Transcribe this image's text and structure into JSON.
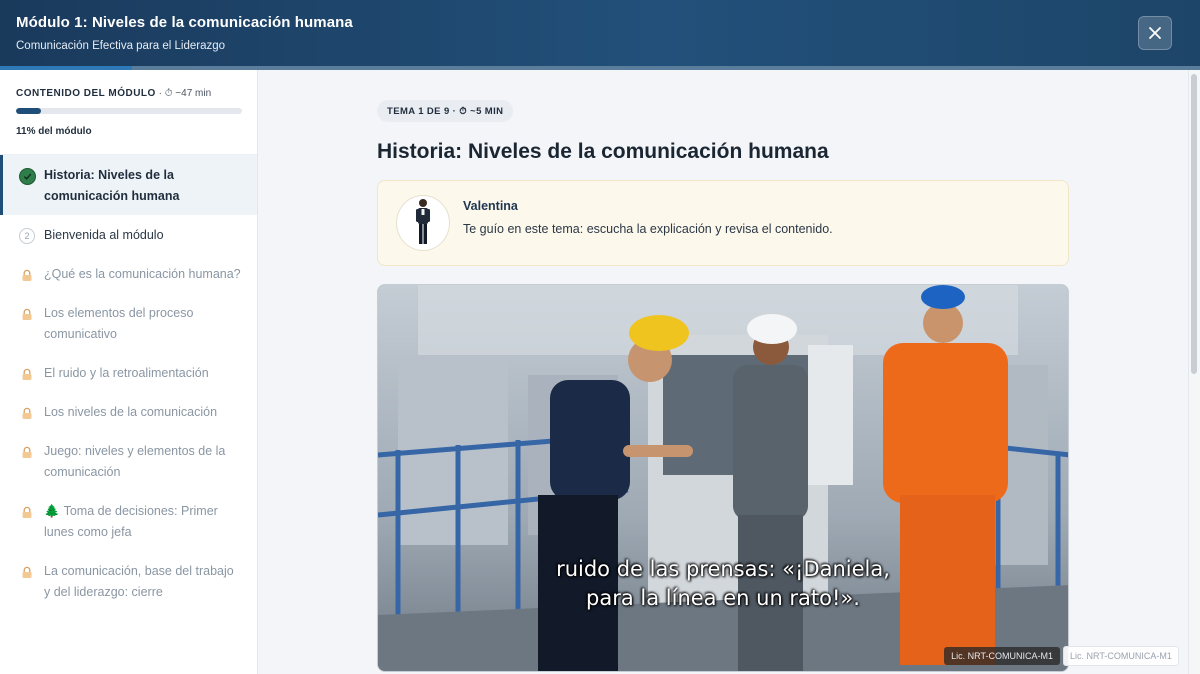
{
  "header": {
    "title": "Módulo 1: Niveles de la comunicación humana",
    "subtitle": "Comunicación Efectiva para el Liderazgo",
    "close_icon": "close-icon",
    "progress": 0.11
  },
  "sidebar": {
    "heading": "CONTENIDO DEL MÓDULO",
    "duration": " · ⏱ ~47 min",
    "progress": 0.11,
    "progress_label": "11% del módulo",
    "items": [
      {
        "label": "Historia: Niveles de la comunicación humana",
        "state": "done",
        "icon": "check-circle-icon"
      },
      {
        "label": "Bienvenida al módulo",
        "state": "next",
        "number": "2",
        "icon": "number-circle-icon"
      },
      {
        "label": "¿Qué es la comunicación humana?",
        "state": "locked",
        "icon": "lock-icon"
      },
      {
        "label": "Los elementos del proceso comunicativo",
        "state": "locked",
        "icon": "lock-icon"
      },
      {
        "label": "El ruido y la retroalimentación",
        "state": "locked",
        "icon": "lock-icon"
      },
      {
        "label": "Los niveles de la comunicación",
        "state": "locked",
        "icon": "lock-icon"
      },
      {
        "label": "Juego: niveles y elementos de la comunicación",
        "state": "locked",
        "icon": "lock-icon"
      },
      {
        "label": "Toma de decisiones: Primer lunes como jefa",
        "state": "locked",
        "icon": "lock-icon",
        "prefix_icon": "tree-icon"
      },
      {
        "label": "La comunicación, base del trabajo y del liderazgo: cierre",
        "state": "locked",
        "icon": "lock-icon"
      }
    ]
  },
  "main": {
    "topic_label": "TEMA 1 DE 9 · ⏱ ~5 MIN",
    "topic_title": "Historia: Niveles de la comunicación humana",
    "guide": {
      "name": "Valentina",
      "message": "Te guío en este tema: escucha la explicación y revisa el contenido."
    },
    "video": {
      "caption_line1": "ruido de las prensas: «¡Daniela,",
      "caption_line2": "para la línea en un rato!».",
      "license": "Lic. NRT-COMUNICA-M1"
    }
  },
  "watermark": "Lic. NRT-COMUNICA-M1",
  "colors": {
    "header": "#1f4a70",
    "accent": "#1f4e79",
    "done": "#2e7d4a",
    "guide_bg": "#fdf8ec"
  }
}
